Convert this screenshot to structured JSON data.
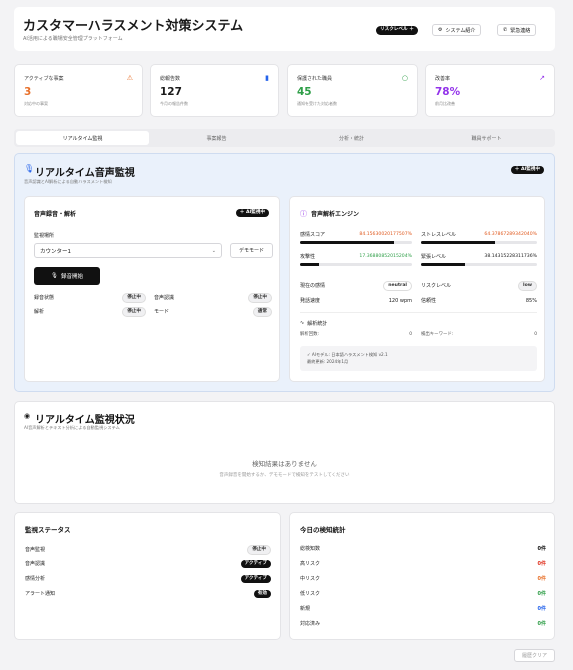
{
  "header": {
    "title": "カスタマーハラスメント対策システム",
    "subtitle": "AI活用による職場安全管理プラットフォーム",
    "risk_badge": "リスクレベル",
    "system_btn": "システム紹介",
    "contact_btn": "緊急連絡"
  },
  "kpis": [
    {
      "label": "アクティブな事案",
      "value": "3",
      "sub": "対応中の事案",
      "color": "#e8712b",
      "icon": "warning-icon"
    },
    {
      "label": "総報告数",
      "value": "127",
      "sub": "今月の報告件数",
      "color": "#111111",
      "icon": "document-icon"
    },
    {
      "label": "保護された職員",
      "value": "45",
      "sub": "通知を受けた対応者数",
      "color": "#2e9e47",
      "icon": "shield-icon"
    },
    {
      "label": "改善率",
      "value": "78%",
      "sub": "前月比改善",
      "color": "#9333ea",
      "icon": "trend-up-icon"
    }
  ],
  "tabs": [
    "リアルタイム監視",
    "事案報告",
    "分析・統計",
    "職員サポート"
  ],
  "monitor": {
    "title": "リアルタイム音声監視",
    "subtitle": "音声認識とAI解析による自動ハラスメント検知",
    "ai_badge": "AI監視中",
    "recording": {
      "title": "音声録音・解析",
      "ai_badge": "AI監視中",
      "location_label": "監視場所",
      "location_value": "カウンター1",
      "demo_btn": "デモモード",
      "start_btn": "録音開始",
      "status": [
        {
          "label": "録音状態",
          "value": "停止中"
        },
        {
          "label": "音声認識",
          "value": "停止中"
        },
        {
          "label": "解析",
          "value": "停止中"
        },
        {
          "label": "モード",
          "value": "通常"
        }
      ]
    },
    "engine": {
      "title": "音声解析エンジン",
      "metrics": [
        {
          "label": "感情スコア",
          "value": "84.15630020177507%",
          "color": "#e05a1f",
          "pct": 84
        },
        {
          "label": "ストレスレベル",
          "value": "64.37867289342040%",
          "color": "#e05a1f",
          "pct": 64
        },
        {
          "label": "攻撃性",
          "value": "17.36880852015204%",
          "color": "#2e9e47",
          "pct": 17
        },
        {
          "label": "緊張レベル",
          "value": "38.14315228311736%",
          "color": "#111111",
          "pct": 38
        }
      ],
      "emotion_label": "現在の感情",
      "emotion_value": "neutral",
      "risk_label": "リスクレベル",
      "risk_value": "low",
      "speed_label": "発話速度",
      "speed_value": "120 wpm",
      "confidence_label": "信頼性",
      "confidence_value": "85%",
      "stats_title": "解析統計",
      "stats_left_label": "解析回数:",
      "stats_left_value": "0",
      "stats_right_label": "検出キーワード:",
      "stats_right_value": "0",
      "note_line1": "AIモデル: 日本語ハラスメント検知 v2.1",
      "note_line2": "最終更新: 2024年1月"
    }
  },
  "detection": {
    "title": "リアルタイム監視状況",
    "subtitle": "AI音声解析とテキスト分析による自動監視システム",
    "empty_title": "検知結果はありません",
    "empty_sub": "音声録音を開始するか、デモモードで検知をテストしてください"
  },
  "status_card": {
    "title": "監視ステータス",
    "items": [
      {
        "label": "音声監視",
        "value": "停止中",
        "style": "light"
      },
      {
        "label": "音声認識",
        "value": "アクティブ",
        "style": "dark"
      },
      {
        "label": "感情分析",
        "value": "アクティブ",
        "style": "dark"
      },
      {
        "label": "アラート通知",
        "value": "有効",
        "style": "dark"
      }
    ]
  },
  "stats_card": {
    "title": "今日の検知統計",
    "items": [
      {
        "label": "総検知数",
        "value": "0件",
        "color": "#111111"
      },
      {
        "label": "高リスク",
        "value": "0件",
        "color": "#e0311f"
      },
      {
        "label": "中リスク",
        "value": "0件",
        "color": "#e8712b"
      },
      {
        "label": "低リスク",
        "value": "0件",
        "color": "#2e9e47"
      },
      {
        "label": "新規",
        "value": "0件",
        "color": "#2563eb"
      },
      {
        "label": "対応済み",
        "value": "0件",
        "color": "#2e9e47"
      }
    ]
  },
  "footer": {
    "clear_btn": "履歴クリア"
  }
}
